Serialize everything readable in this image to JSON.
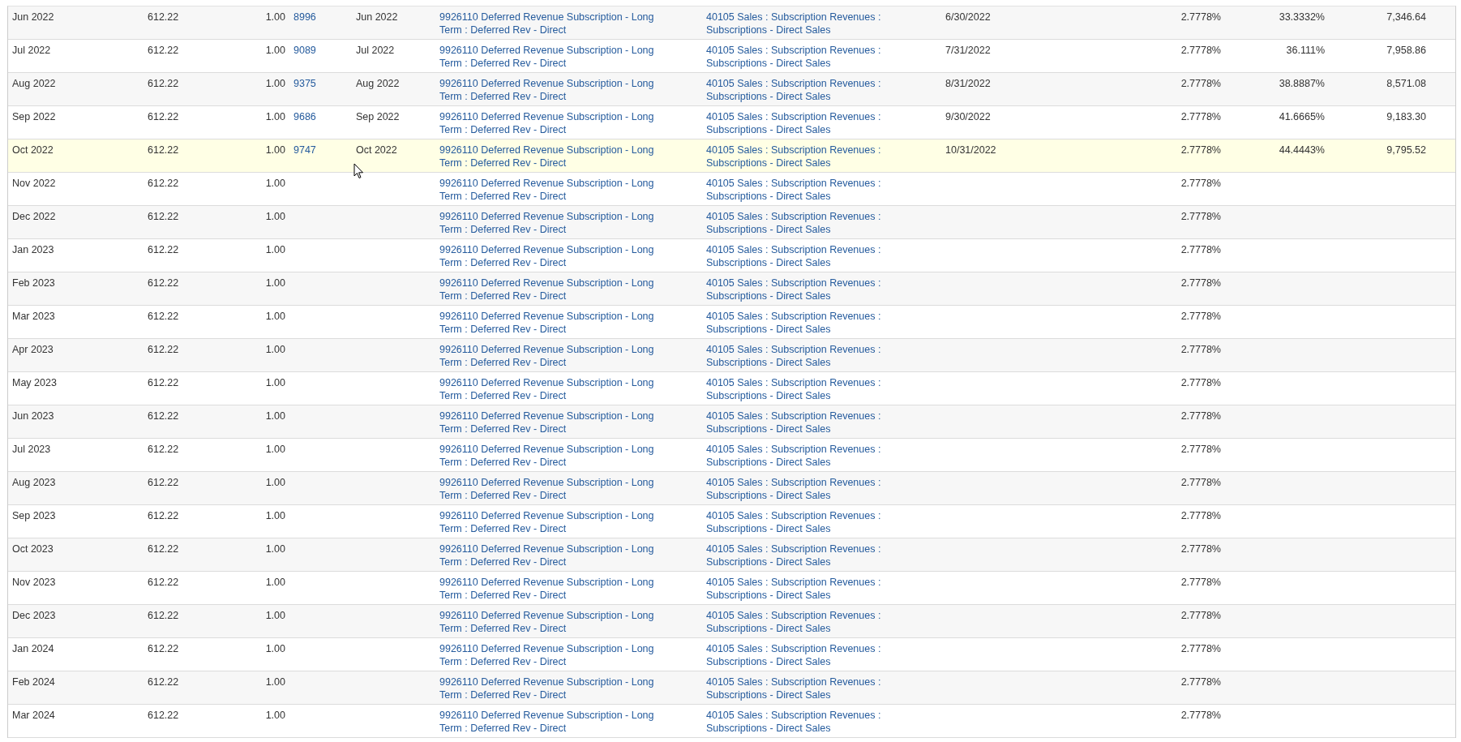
{
  "table": {
    "rows": [
      {
        "period": "Jun 2022",
        "amount": "612.22",
        "quantity": "1.00",
        "journal": "8996",
        "posting_period": "Jun 2022",
        "deferral_account": "9926110 Deferred Revenue Subscription - Long Term : Deferred Rev - Direct",
        "revenue_account": "40105 Sales : Subscription Revenues : Subscriptions - Direct Sales",
        "date": "6/30/2022",
        "percent": "2.7778%",
        "cumulative_percent": "33.3332%",
        "cumulative_amount": "7,346.64",
        "selected": false
      },
      {
        "period": "Jul 2022",
        "amount": "612.22",
        "quantity": "1.00",
        "journal": "9089",
        "posting_period": "Jul 2022",
        "deferral_account": "9926110 Deferred Revenue Subscription - Long Term : Deferred Rev - Direct",
        "revenue_account": "40105 Sales : Subscription Revenues : Subscriptions - Direct Sales",
        "date": "7/31/2022",
        "percent": "2.7778%",
        "cumulative_percent": "36.111%",
        "cumulative_amount": "7,958.86",
        "selected": false
      },
      {
        "period": "Aug 2022",
        "amount": "612.22",
        "quantity": "1.00",
        "journal": "9375",
        "posting_period": "Aug 2022",
        "deferral_account": "9926110 Deferred Revenue Subscription - Long Term : Deferred Rev - Direct",
        "revenue_account": "40105 Sales : Subscription Revenues : Subscriptions - Direct Sales",
        "date": "8/31/2022",
        "percent": "2.7778%",
        "cumulative_percent": "38.8887%",
        "cumulative_amount": "8,571.08",
        "selected": false
      },
      {
        "period": "Sep 2022",
        "amount": "612.22",
        "quantity": "1.00",
        "journal": "9686",
        "posting_period": "Sep 2022",
        "deferral_account": "9926110 Deferred Revenue Subscription - Long Term : Deferred Rev - Direct",
        "revenue_account": "40105 Sales : Subscription Revenues : Subscriptions - Direct Sales",
        "date": "9/30/2022",
        "percent": "2.7778%",
        "cumulative_percent": "41.6665%",
        "cumulative_amount": "9,183.30",
        "selected": false
      },
      {
        "period": "Oct 2022",
        "amount": "612.22",
        "quantity": "1.00",
        "journal": "9747",
        "posting_period": "Oct 2022",
        "deferral_account": "9926110 Deferred Revenue Subscription - Long Term : Deferred Rev - Direct",
        "revenue_account": "40105 Sales : Subscription Revenues : Subscriptions - Direct Sales",
        "date": "10/31/2022",
        "percent": "2.7778%",
        "cumulative_percent": "44.4443%",
        "cumulative_amount": "9,795.52",
        "selected": true
      },
      {
        "period": "Nov 2022",
        "amount": "612.22",
        "quantity": "1.00",
        "deferral_account": "9926110 Deferred Revenue Subscription - Long Term : Deferred Rev - Direct",
        "revenue_account": "40105 Sales : Subscription Revenues : Subscriptions - Direct Sales",
        "percent": "2.7778%",
        "selected": false
      },
      {
        "period": "Dec 2022",
        "amount": "612.22",
        "quantity": "1.00",
        "deferral_account": "9926110 Deferred Revenue Subscription - Long Term : Deferred Rev - Direct",
        "revenue_account": "40105 Sales : Subscription Revenues : Subscriptions - Direct Sales",
        "percent": "2.7778%",
        "selected": false
      },
      {
        "period": "Jan 2023",
        "amount": "612.22",
        "quantity": "1.00",
        "deferral_account": "9926110 Deferred Revenue Subscription - Long Term : Deferred Rev - Direct",
        "revenue_account": "40105 Sales : Subscription Revenues : Subscriptions - Direct Sales",
        "percent": "2.7778%",
        "selected": false
      },
      {
        "period": "Feb 2023",
        "amount": "612.22",
        "quantity": "1.00",
        "deferral_account": "9926110 Deferred Revenue Subscription - Long Term : Deferred Rev - Direct",
        "revenue_account": "40105 Sales : Subscription Revenues : Subscriptions - Direct Sales",
        "percent": "2.7778%",
        "selected": false
      },
      {
        "period": "Mar 2023",
        "amount": "612.22",
        "quantity": "1.00",
        "deferral_account": "9926110 Deferred Revenue Subscription - Long Term : Deferred Rev - Direct",
        "revenue_account": "40105 Sales : Subscription Revenues : Subscriptions - Direct Sales",
        "percent": "2.7778%",
        "selected": false
      },
      {
        "period": "Apr 2023",
        "amount": "612.22",
        "quantity": "1.00",
        "deferral_account": "9926110 Deferred Revenue Subscription - Long Term : Deferred Rev - Direct",
        "revenue_account": "40105 Sales : Subscription Revenues : Subscriptions - Direct Sales",
        "percent": "2.7778%",
        "selected": false
      },
      {
        "period": "May 2023",
        "amount": "612.22",
        "quantity": "1.00",
        "deferral_account": "9926110 Deferred Revenue Subscription - Long Term : Deferred Rev - Direct",
        "revenue_account": "40105 Sales : Subscription Revenues : Subscriptions - Direct Sales",
        "percent": "2.7778%",
        "selected": false
      },
      {
        "period": "Jun 2023",
        "amount": "612.22",
        "quantity": "1.00",
        "deferral_account": "9926110 Deferred Revenue Subscription - Long Term : Deferred Rev - Direct",
        "revenue_account": "40105 Sales : Subscription Revenues : Subscriptions - Direct Sales",
        "percent": "2.7778%",
        "selected": false
      },
      {
        "period": "Jul 2023",
        "amount": "612.22",
        "quantity": "1.00",
        "deferral_account": "9926110 Deferred Revenue Subscription - Long Term : Deferred Rev - Direct",
        "revenue_account": "40105 Sales : Subscription Revenues : Subscriptions - Direct Sales",
        "percent": "2.7778%",
        "selected": false
      },
      {
        "period": "Aug 2023",
        "amount": "612.22",
        "quantity": "1.00",
        "deferral_account": "9926110 Deferred Revenue Subscription - Long Term : Deferred Rev - Direct",
        "revenue_account": "40105 Sales : Subscription Revenues : Subscriptions - Direct Sales",
        "percent": "2.7778%",
        "selected": false
      },
      {
        "period": "Sep 2023",
        "amount": "612.22",
        "quantity": "1.00",
        "deferral_account": "9926110 Deferred Revenue Subscription - Long Term : Deferred Rev - Direct",
        "revenue_account": "40105 Sales : Subscription Revenues : Subscriptions - Direct Sales",
        "percent": "2.7778%",
        "selected": false
      },
      {
        "period": "Oct 2023",
        "amount": "612.22",
        "quantity": "1.00",
        "deferral_account": "9926110 Deferred Revenue Subscription - Long Term : Deferred Rev - Direct",
        "revenue_account": "40105 Sales : Subscription Revenues : Subscriptions - Direct Sales",
        "percent": "2.7778%",
        "selected": false
      },
      {
        "period": "Nov 2023",
        "amount": "612.22",
        "quantity": "1.00",
        "deferral_account": "9926110 Deferred Revenue Subscription - Long Term : Deferred Rev - Direct",
        "revenue_account": "40105 Sales : Subscription Revenues : Subscriptions - Direct Sales",
        "percent": "2.7778%",
        "selected": false
      },
      {
        "period": "Dec 2023",
        "amount": "612.22",
        "quantity": "1.00",
        "deferral_account": "9926110 Deferred Revenue Subscription - Long Term : Deferred Rev - Direct",
        "revenue_account": "40105 Sales : Subscription Revenues : Subscriptions - Direct Sales",
        "percent": "2.7778%",
        "selected": false
      },
      {
        "period": "Jan 2024",
        "amount": "612.22",
        "quantity": "1.00",
        "deferral_account": "9926110 Deferred Revenue Subscription - Long Term : Deferred Rev - Direct",
        "revenue_account": "40105 Sales : Subscription Revenues : Subscriptions - Direct Sales",
        "percent": "2.7778%",
        "selected": false
      },
      {
        "period": "Feb 2024",
        "amount": "612.22",
        "quantity": "1.00",
        "deferral_account": "9926110 Deferred Revenue Subscription - Long Term : Deferred Rev - Direct",
        "revenue_account": "40105 Sales : Subscription Revenues : Subscriptions - Direct Sales",
        "percent": "2.7778%",
        "selected": false
      },
      {
        "period": "Mar 2024",
        "amount": "612.22",
        "quantity": "1.00",
        "deferral_account": "9926110 Deferred Revenue Subscription - Long Term : Deferred Rev - Direct",
        "revenue_account": "40105 Sales : Subscription Revenues : Subscriptions - Direct Sales",
        "percent": "2.7778%",
        "selected": false
      }
    ]
  }
}
